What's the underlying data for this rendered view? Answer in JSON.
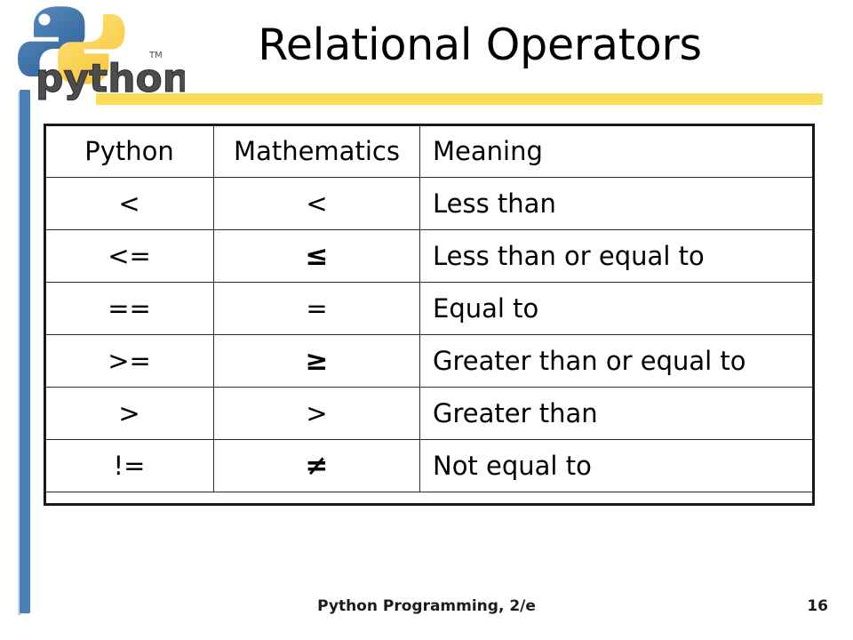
{
  "slide": {
    "title": "Relational Operators",
    "accent_yellow": "#fadc5a",
    "accent_blue": "#4a81b4",
    "background": "#ffffff"
  },
  "logo": {
    "name": "python-logo",
    "wordmark": "python",
    "trademark": "TM",
    "blue": "#3a6ea5",
    "yellow": "#fcd253"
  },
  "table": {
    "headers": {
      "python": "Python",
      "mathematics": "Mathematics",
      "meaning": "Meaning"
    },
    "rows": [
      {
        "python": "<",
        "math": "<",
        "meaning": "Less than"
      },
      {
        "python": "<=",
        "math": "≤",
        "meaning": "Less than or equal to"
      },
      {
        "python": "==",
        "math": "=",
        "meaning": "Equal to"
      },
      {
        "python": ">=",
        "math": "≥",
        "meaning": "Greater than or equal to"
      },
      {
        "python": ">",
        "math": ">",
        "meaning": "Greater than"
      },
      {
        "python": "!=",
        "math": "≠",
        "meaning": "Not equal to"
      }
    ]
  },
  "footer": {
    "text": "Python Programming, 2/e",
    "page_number": "16"
  }
}
